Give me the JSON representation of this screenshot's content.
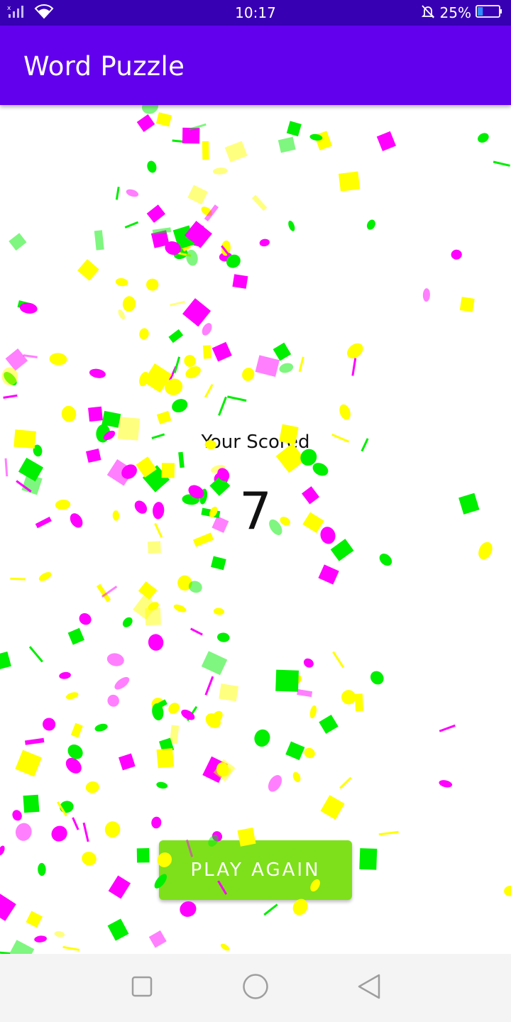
{
  "status_bar": {
    "time": "10:17",
    "battery_percent": "25%",
    "battery_level": 0.25,
    "icons": [
      "signal-icon",
      "wifi-icon",
      "mute-bell-icon",
      "battery-icon"
    ]
  },
  "app_bar": {
    "title": "Word Puzzle"
  },
  "result": {
    "label": "Your Scored",
    "score": "7"
  },
  "actions": {
    "play_again_label": "PLAY AGAIN"
  },
  "nav_bar": {
    "icons": [
      "recents-icon",
      "home-icon",
      "back-icon"
    ]
  },
  "colors": {
    "status_bar": "#3700b3",
    "app_bar": "#6200ee",
    "button": "#7ee01a",
    "confetti": [
      "#ff00ff",
      "#ffff00",
      "#00ee00"
    ]
  }
}
